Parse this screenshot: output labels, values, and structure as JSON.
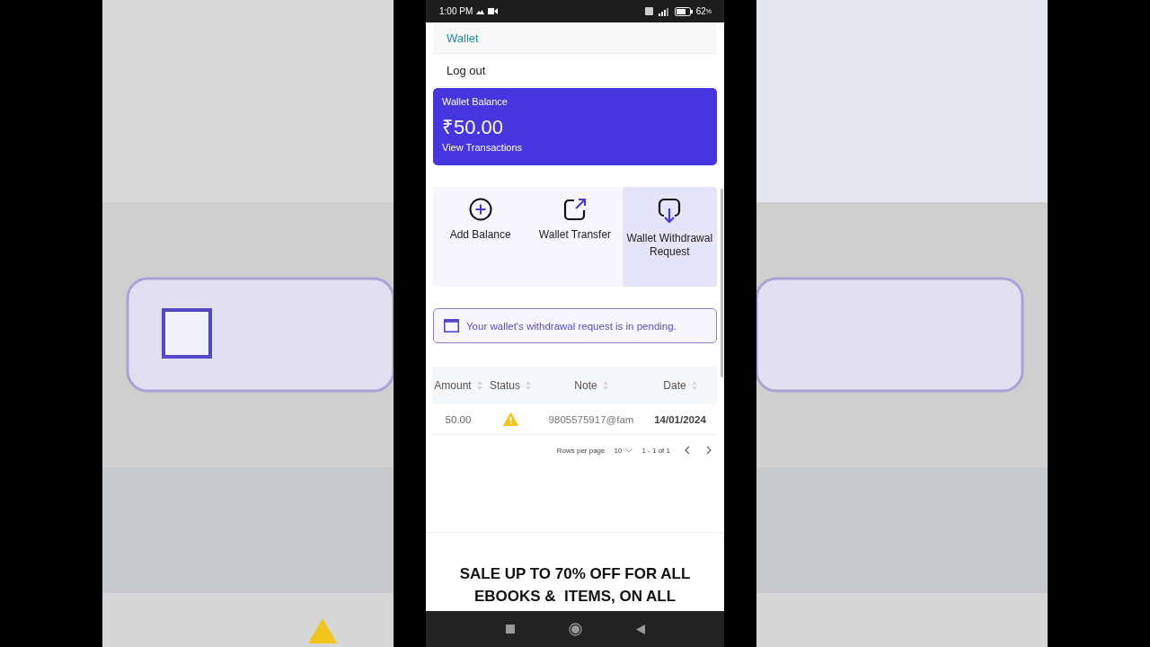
{
  "status_bar": {
    "time": "1:00 PM",
    "battery": "62",
    "battery_unit": "%"
  },
  "menu": [
    {
      "label": "Wallet",
      "selected": true
    },
    {
      "label": "Log out",
      "selected": false
    }
  ],
  "balance_card": {
    "title": "Wallet Balance",
    "amount": "₹50.00",
    "link": "View Transactions"
  },
  "actions": [
    {
      "kind": "add",
      "label": "Add Balance",
      "selected": false
    },
    {
      "kind": "transfer",
      "label": "Wallet Transfer",
      "selected": false
    },
    {
      "kind": "withdraw",
      "label": "Wallet Withdrawal Request",
      "selected": true
    }
  ],
  "alert": {
    "text": "Your wallet's withdrawal request is in pending."
  },
  "table": {
    "columns": [
      "Amount",
      "Status",
      "Note",
      "Date"
    ],
    "rows": [
      {
        "amount": "50.00",
        "kind": "warning",
        "note": "9805575917@fam",
        "date": "14/01/2024"
      }
    ]
  },
  "pagination": {
    "label": "Rows per page",
    "rows_per_page": "10",
    "range": "1 - 1 of 1"
  },
  "promo": {
    "lines": [
      "SALE UP TO 70% OFF FOR ALL",
      "EBOOKS &  ITEMS, ON ALL"
    ]
  }
}
